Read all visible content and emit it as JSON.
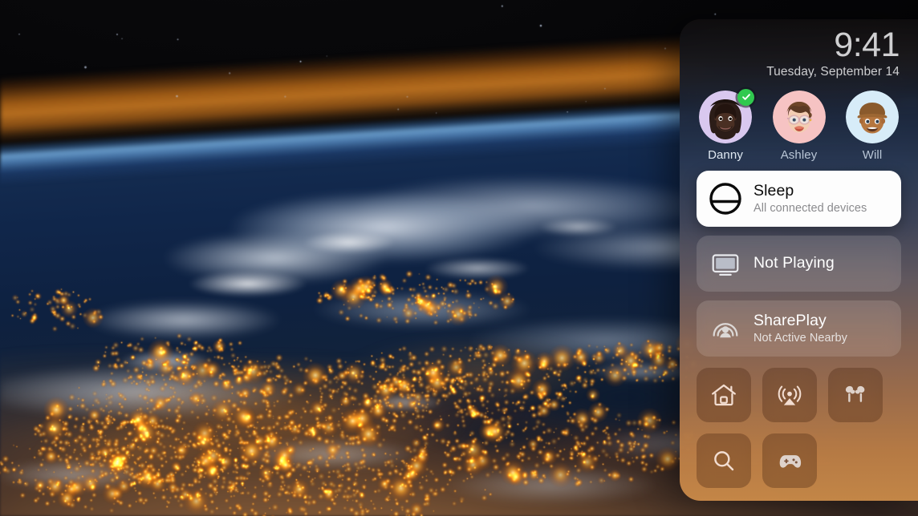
{
  "background": {
    "name": "earth-from-orbit-aerial",
    "description": "Night view of Earth from orbit with city lights, clouds and orange atmospheric limb"
  },
  "panel": {
    "name": "control-center",
    "header": {
      "time": "9:41",
      "date": "Tuesday, September 14"
    },
    "profiles": [
      {
        "name": "Danny",
        "selected": true,
        "checkmark": true,
        "avatar_bg": "#d9c8ef",
        "icon": "memoji-danny-avatar"
      },
      {
        "name": "Ashley",
        "selected": false,
        "checkmark": false,
        "avatar_bg": "#f6c3c3",
        "icon": "memoji-ashley-avatar"
      },
      {
        "name": "Will",
        "selected": false,
        "checkmark": false,
        "avatar_bg": "#d7ecf8",
        "icon": "memoji-will-avatar"
      }
    ],
    "rows": [
      {
        "id": "sleep",
        "title": "Sleep",
        "subtitle": "All connected devices",
        "icon": "sleep-icon",
        "focused": true
      },
      {
        "id": "now-playing",
        "title": "Not Playing",
        "subtitle": "",
        "icon": "tv-display-icon",
        "focused": false
      },
      {
        "id": "shareplay",
        "title": "SharePlay",
        "subtitle": "Not Active Nearby",
        "icon": "shareplay-icon",
        "focused": false
      }
    ],
    "tiles": [
      {
        "id": "home",
        "icon": "home-house-icon",
        "label": "Home"
      },
      {
        "id": "airplay",
        "icon": "airplay-icon",
        "label": "AirPlay"
      },
      {
        "id": "airpods",
        "icon": "airpods-icon",
        "label": "AirPods"
      },
      {
        "id": "search",
        "icon": "search-icon",
        "label": "Search"
      },
      {
        "id": "game-center",
        "icon": "game-controller-icon",
        "label": "Game Controllers"
      }
    ]
  },
  "colors": {
    "accent_green": "#30c94f",
    "focused_card_bg": "#fdfdfd",
    "panel_top": "#0e0d0e",
    "panel_bottom": "#c88948",
    "clock_text": "#cfcfd1",
    "profile_name": "#b9c6d6"
  }
}
